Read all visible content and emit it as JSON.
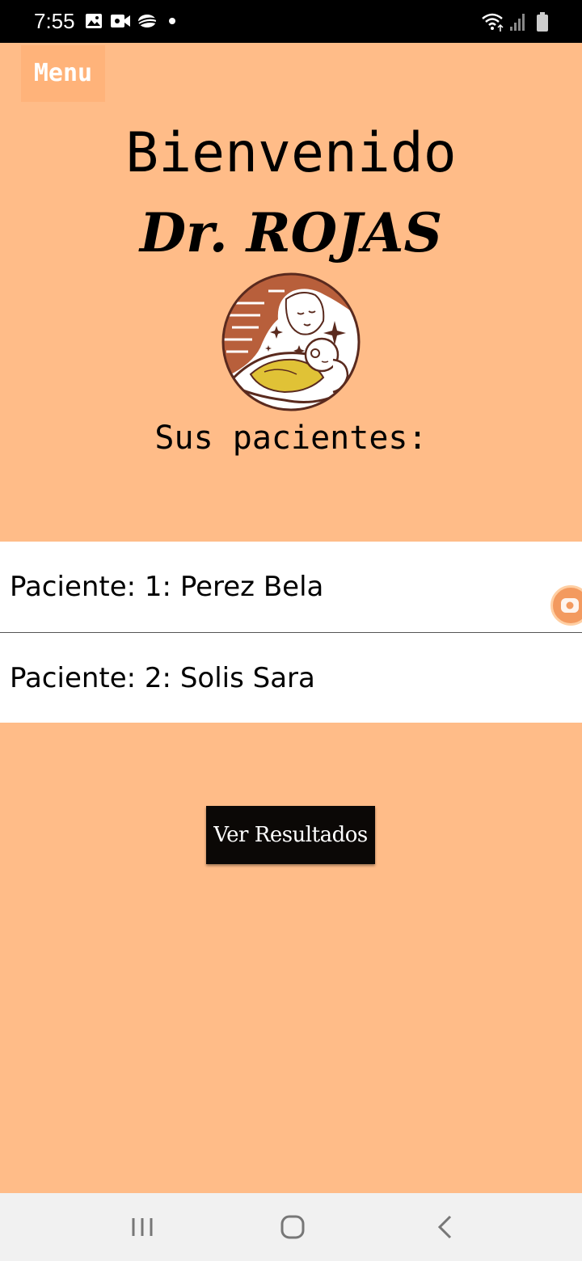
{
  "status_bar": {
    "time": "7:55",
    "icons_left": [
      "image-icon",
      "video-icon",
      "cloud-icon",
      "dot-icon"
    ],
    "icons_right": [
      "wifi-icon",
      "signal-icon",
      "battery-icon"
    ]
  },
  "header": {
    "menu_label": "Menu",
    "welcome": "Bienvenido",
    "doctor_name": "Dr. ROJAS"
  },
  "logo": {
    "icon": "mother-baby-logo",
    "colors": {
      "ring": "#5a2a1e",
      "hair": "#b85f3b",
      "blanket": "#e0c236",
      "background": "#ffffff"
    }
  },
  "patients": {
    "heading": "Sus pacientes:",
    "items": [
      {
        "label": "Paciente: 1: Perez Bela"
      },
      {
        "label": "Paciente: 2: Solis Sara"
      }
    ]
  },
  "actions": {
    "results_label": "Ver Resultados"
  },
  "nav_bar": {
    "buttons": [
      "recent-apps-icon",
      "home-icon",
      "back-icon"
    ]
  },
  "colors": {
    "background": "#ffbc88",
    "menu_button": "#ffb37a",
    "results_button": "#0b0806",
    "list_background": "#ffffff",
    "status_bar": "#000000",
    "nav_bar": "#f1f1f1"
  }
}
